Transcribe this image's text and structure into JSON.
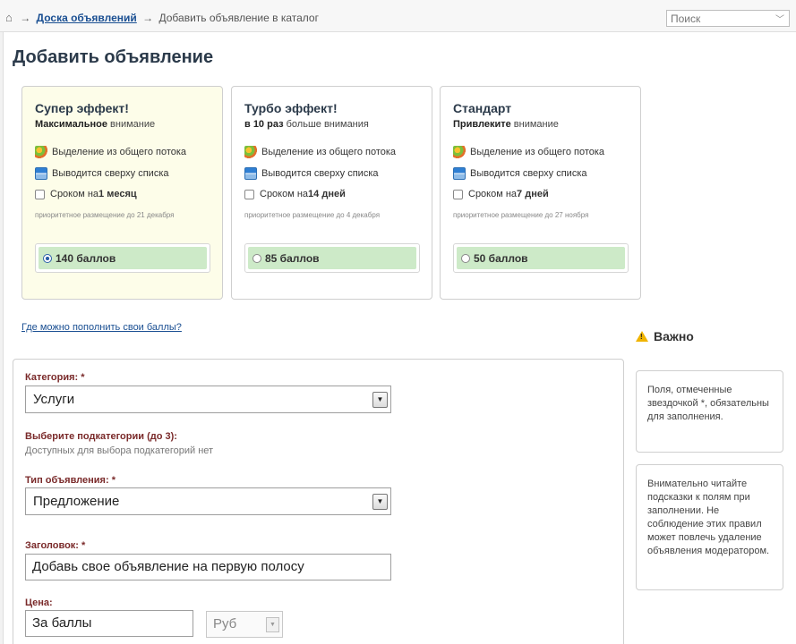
{
  "breadcrumb": {
    "home_icon": "home-icon",
    "arrow": "→",
    "link": "Доска объявлений",
    "current": "Добавить объявление в каталог"
  },
  "search": {
    "placeholder": "Поиск"
  },
  "page_title": "Добавить объявление",
  "plans": [
    {
      "title": "Супер эффект!",
      "sub_bold": "Максимальное",
      "sub_rest": " внимание",
      "feature1": "Выделение из общего потока",
      "feature2": "Выводится сверху списка",
      "term_prefix": "Сроком на ",
      "term_bold": "1 месяц",
      "note": "приоритетное размещение до 21 декабря",
      "price": "140 баллов",
      "selected": true
    },
    {
      "title": "Турбо эффект!",
      "sub_bold": "в 10 раз",
      "sub_rest": " больше внимания",
      "feature1": "Выделение из общего потока",
      "feature2": "Выводится сверху списка",
      "term_prefix": "Сроком на ",
      "term_bold": "14 дней",
      "note": "приоритетное размещение до 4 декабря",
      "price": "85 баллов",
      "selected": false
    },
    {
      "title": "Стандарт",
      "sub_bold": "Привлеките",
      "sub_rest": " внимание",
      "feature1": "Выделение из общего потока",
      "feature2": "Выводится сверху списка",
      "term_prefix": "Сроком на ",
      "term_bold": "7 дней",
      "note": "приоритетное размещение до 27 ноября",
      "price": "50 баллов",
      "selected": false
    }
  ],
  "refill_link": "Где можно пополнить свои баллы?",
  "form": {
    "category_label": "Категория: *",
    "category_value": "Услуги",
    "subcat_label": "Выберите подкатегории (до 3):",
    "subcat_hint": "Доступных для выбора подкатегорий нет",
    "type_label": "Тип объявления: *",
    "type_value": "Предложение",
    "headline_label": "Заголовок: *",
    "headline_value": "Добавь свое объявление на первую полосу",
    "price_label": "Цена:",
    "price_value": "За баллы",
    "currency_value": "Руб"
  },
  "sidebar": {
    "important_title": "Важно",
    "note1": "Поля, отмеченные звездочкой *, обязательны для заполнения.",
    "note2": "Внимательно читайте подсказки к полям при заполнении. Не соблюдение этих правил может повлечь удаление объявления модератором."
  },
  "colors": {
    "accent_link": "#1a4f92",
    "price_green": "#cdeac8",
    "active_card_bg": "#fdfde9",
    "label_red": "#7a2a2a"
  }
}
